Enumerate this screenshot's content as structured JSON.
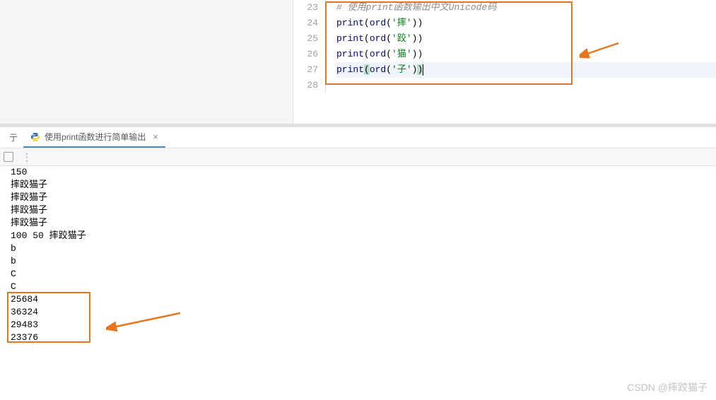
{
  "editor": {
    "gutter": [
      "23",
      "24",
      "25",
      "26",
      "27",
      "28"
    ],
    "comment": "# 使用print函数输出中文Unicode码",
    "lines": [
      {
        "fn": "print",
        "bi": "ord",
        "arg": "'摔'"
      },
      {
        "fn": "print",
        "bi": "ord",
        "arg": "'跤'"
      },
      {
        "fn": "print",
        "bi": "ord",
        "arg": "'猫'"
      },
      {
        "fn": "print",
        "bi": "ord",
        "arg": "'子'"
      }
    ]
  },
  "tab": {
    "edge_label": "亍",
    "title": "使用print函数进行简单输出"
  },
  "console": {
    "lines": [
      "150",
      "摔跤猫子",
      "摔跤猫子",
      "摔跤猫子",
      "摔跤猫子",
      "100 50 摔跤猫子",
      "b",
      "b",
      "C",
      "C",
      "25684",
      "36324",
      "29483",
      "23376"
    ]
  },
  "watermark": "CSDN @摔跤猫子"
}
